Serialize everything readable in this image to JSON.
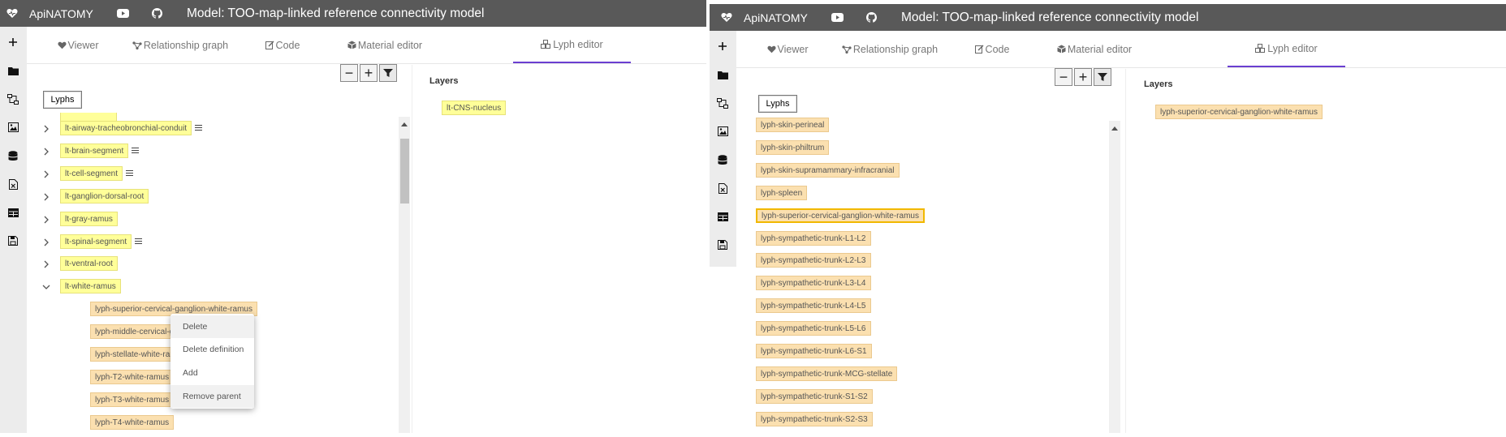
{
  "app": {
    "name": "ApiNATOMY",
    "model_title": "Model: TOO-map-linked reference connectivity model"
  },
  "colors": {
    "topbar": "#595959",
    "active_tab": "#6a3fd1",
    "lyph_yellow": "#ffff99",
    "lyph_orange": "#fbe0b0",
    "selected_border": "#f1b800"
  },
  "tabs": [
    {
      "label": "Viewer",
      "icon": "heart-icon"
    },
    {
      "label": "Relationship graph",
      "icon": "graph-icon"
    },
    {
      "label": "Code",
      "icon": "edit-icon"
    },
    {
      "label": "Material editor",
      "icon": "cube-icon"
    },
    {
      "label": "Lyph editor",
      "icon": "cubes-icon"
    }
  ],
  "sidebar_icons": [
    "plus-icon",
    "folder-icon",
    "merge-icon",
    "image-icon",
    "database-icon",
    "excel-icon",
    "table-icon",
    "save-icon"
  ],
  "left": {
    "lyphs_button": "Lyphs",
    "layers_label": "Layers",
    "layers": [
      "lt-CNS-nucleus"
    ],
    "tree": [
      {
        "label": "lt-airway-tracheobronchial-conduit",
        "menu": true
      },
      {
        "label": "lt-brain-segment",
        "menu": true
      },
      {
        "label": "lt-cell-segment",
        "menu": true
      },
      {
        "label": "lt-ganglion-dorsal-root",
        "menu": false
      },
      {
        "label": "lt-gray-ramus",
        "menu": false
      },
      {
        "label": "lt-spinal-segment",
        "menu": true
      },
      {
        "label": "lt-ventral-root",
        "menu": false
      },
      {
        "label": "lt-white-ramus",
        "menu": false,
        "expanded": true
      }
    ],
    "children": [
      "lyph-superior-cervical-ganglion-white-ramus",
      "lyph-middle-cervical-ganglion-white-ramus",
      "lyph-stellate-white-ramus",
      "lyph-T2-white-ramus",
      "lyph-T3-white-ramus",
      "lyph-T4-white-ramus"
    ],
    "context_menu": [
      "Delete",
      "Delete definition",
      "Add",
      "Remove parent"
    ]
  },
  "right": {
    "lyphs_button": "Lyphs",
    "layers_label": "Layers",
    "layers": [
      "lyph-superior-cervical-ganglion-white-ramus"
    ],
    "list": [
      "lyph-skin-perineal",
      "lyph-skin-philtrum",
      "lyph-skin-supramammary-infracranial",
      "lyph-spleen",
      "lyph-superior-cervical-ganglion-white-ramus",
      "lyph-sympathetic-trunk-L1-L2",
      "lyph-sympathetic-trunk-L2-L3",
      "lyph-sympathetic-trunk-L3-L4",
      "lyph-sympathetic-trunk-L4-L5",
      "lyph-sympathetic-trunk-L5-L6",
      "lyph-sympathetic-trunk-L6-S1",
      "lyph-sympathetic-trunk-MCG-stellate",
      "lyph-sympathetic-trunk-S1-S2",
      "lyph-sympathetic-trunk-S2-S3"
    ],
    "selected_index": 4
  }
}
